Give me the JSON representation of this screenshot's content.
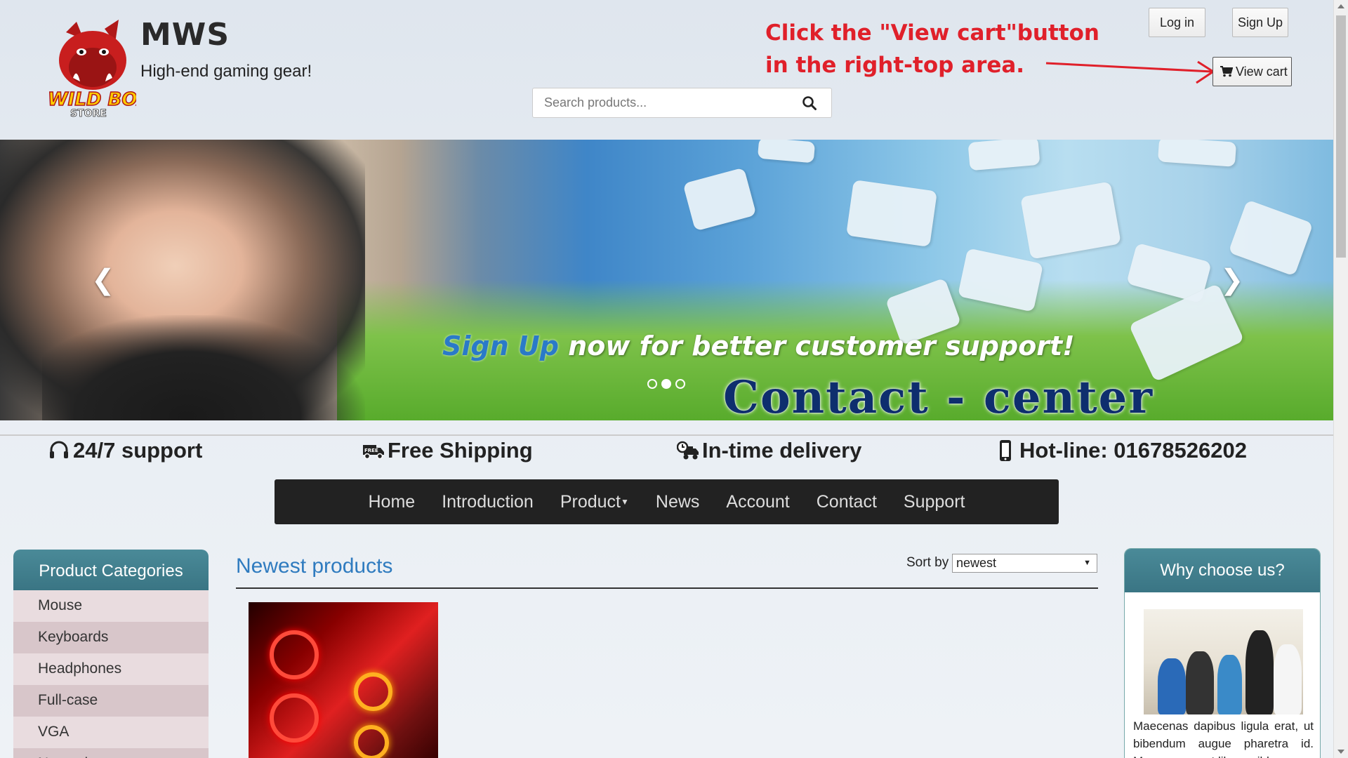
{
  "header": {
    "site_name": "MWS",
    "tagline": "High-end gaming gear!",
    "logo_text": "WILD BOAR STORE",
    "search_placeholder": "Search products...",
    "login_label": "Log in",
    "signup_label": "Sign Up",
    "cart_label": "View cart"
  },
  "annotation": {
    "line1": "Click the \"View cart\"button",
    "line2": "in the right-top area."
  },
  "banner": {
    "caption_highlight": "Sign Up",
    "caption_rest": " now for better customer support!",
    "contact_text": "Contact - center",
    "puzzle_text": "Contact center",
    "active_slide": 2,
    "slide_count": 3
  },
  "features": {
    "support": "24/7 support",
    "shipping": "Free Shipping",
    "delivery": "In-time delivery",
    "hotline": "Hot-line: 01678526202"
  },
  "nav": {
    "items": [
      "Home",
      "Introduction",
      "Product",
      "News",
      "Account",
      "Contact",
      "Support"
    ]
  },
  "categories": {
    "title": "Product Categories",
    "items": [
      "Mouse",
      "Keyboards",
      "Headphones",
      "Full-case",
      "VGA",
      "Network"
    ]
  },
  "main": {
    "title": "Newest products",
    "sort_label": "Sort by",
    "sort_value": "newest"
  },
  "why": {
    "title": "Why choose us?",
    "text": "Maecenas dapibus ligula erat, ut bibendum augue pharetra id. Maecenas eget libero nibh"
  },
  "colors": {
    "accent": "#2f7bbf",
    "annotation": "#e0202a",
    "nav_bg": "#222222",
    "panel_head": "#3a7584"
  }
}
